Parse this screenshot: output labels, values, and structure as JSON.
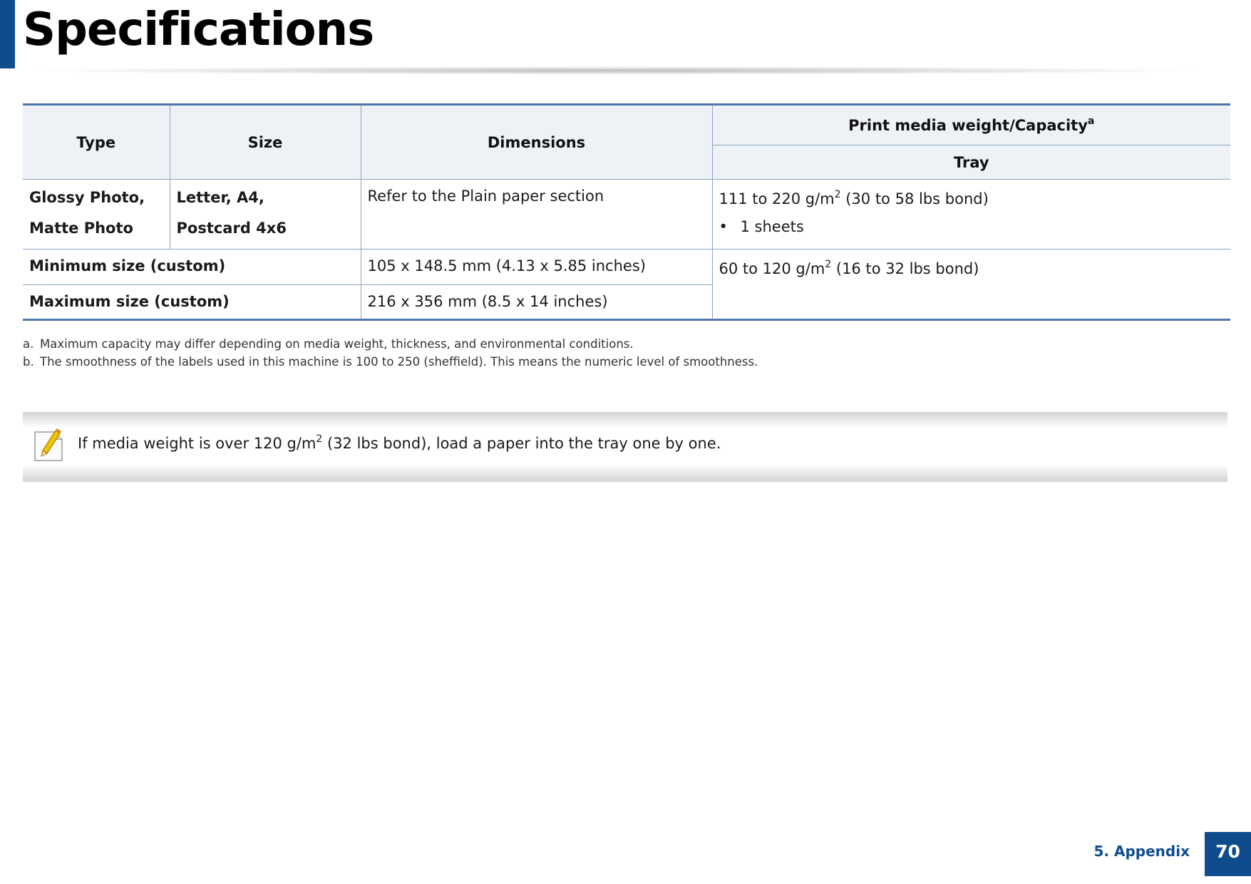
{
  "page": {
    "title": "Specifications"
  },
  "table": {
    "headers": {
      "type": "Type",
      "size": "Size",
      "dimensions": "Dimensions",
      "weight": "Print media weight/Capacity",
      "weight_note_mark": "a",
      "tray": "Tray"
    },
    "rows": {
      "glossy": {
        "type_line1": "Glossy Photo,",
        "type_line2": "Matte Photo",
        "size_line1": "Letter, A4,",
        "size_line2": "Postcard 4x6",
        "dimensions": "Refer to the Plain paper section",
        "weight_prefix": "111 to 220 g/m",
        "weight_exp": "2",
        "weight_suffix": " (30 to 58 lbs bond)",
        "bullet": "•",
        "capacity": "1 sheets"
      },
      "minimum": {
        "label": "Minimum size (custom)",
        "dimensions": "105 x 148.5 mm (4.13 x 5.85 inches)",
        "weight_prefix": "60 to 120 g/m",
        "weight_exp": "2",
        "weight_suffix": " (16 to 32 lbs bond)"
      },
      "maximum": {
        "label": "Maximum size (custom)",
        "dimensions": "216 x 356 mm (8.5 x 14 inches)"
      }
    }
  },
  "footnotes": [
    {
      "mark": "a.",
      "text": "Maximum capacity may differ depending on media weight, thickness, and environmental conditions."
    },
    {
      "mark": "b.",
      "text": "The smoothness of the labels used in this machine is 100 to 250 (sheffield). This means the numeric level of smoothness."
    }
  ],
  "note": {
    "icon": "note-pencil-icon",
    "text_prefix": "If media weight is over 120 g/m",
    "text_exp": "2",
    "text_suffix": " (32 lbs bond), load a paper into the tray one by one."
  },
  "footer": {
    "section": "5.  Appendix",
    "page_number": "70"
  },
  "colors": {
    "brand_blue": "#0f4c8e",
    "table_rule": "#4c76ad",
    "header_bg": "#eef2f6"
  }
}
